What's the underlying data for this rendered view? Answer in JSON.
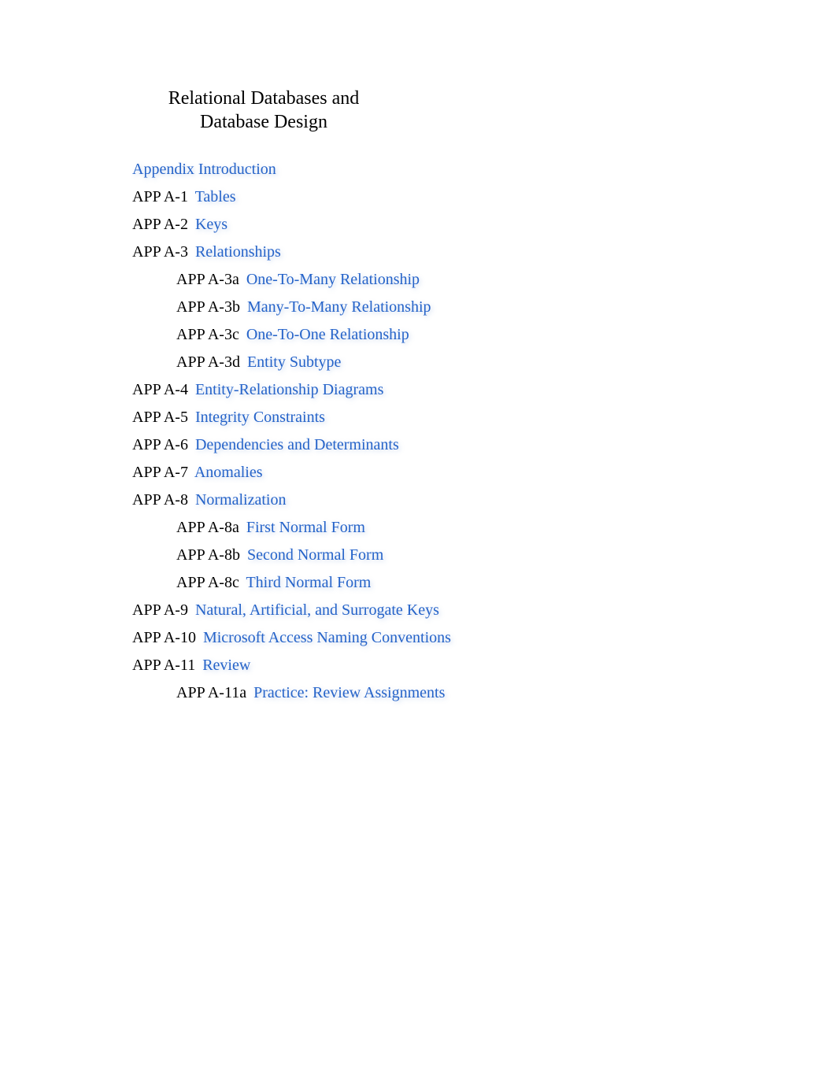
{
  "title": "Relational Databases and Database Design",
  "items": [
    {
      "prefix": "",
      "label": "Appendix Introduction",
      "children": []
    },
    {
      "prefix": "APP A-1",
      "label": "Tables",
      "children": []
    },
    {
      "prefix": "APP A-2",
      "label": "Keys",
      "children": []
    },
    {
      "prefix": "APP A-3",
      "label": "Relationships",
      "children": [
        {
          "prefix": "APP A-3a",
          "label": "One-To-Many Relationship"
        },
        {
          "prefix": "APP A-3b",
          "label": "Many-To-Many Relationship"
        },
        {
          "prefix": "APP A-3c",
          "label": "One-To-One Relationship"
        },
        {
          "prefix": "APP A-3d",
          "label": "Entity Subtype"
        }
      ]
    },
    {
      "prefix": "APP A-4",
      "label": "Entity-Relationship Diagrams",
      "children": []
    },
    {
      "prefix": "APP A-5",
      "label": "Integrity Constraints",
      "children": []
    },
    {
      "prefix": "APP A-6",
      "label": "Dependencies and Determinants",
      "children": []
    },
    {
      "prefix": "APP A-7",
      "label": "Anomalies",
      "children": []
    },
    {
      "prefix": "APP A-8",
      "label": "Normalization",
      "children": [
        {
          "prefix": "APP A-8a",
          "label": "First Normal Form"
        },
        {
          "prefix": "APP A-8b",
          "label": "Second Normal Form"
        },
        {
          "prefix": "APP A-8c",
          "label": "Third Normal Form"
        }
      ]
    },
    {
      "prefix": "APP A-9",
      "label": "Natural, Artificial, and Surrogate Keys",
      "children": []
    },
    {
      "prefix": "APP A-10",
      "label": "Microsoft Access Naming Conventions",
      "children": []
    },
    {
      "prefix": "APP A-11",
      "label": "Review",
      "children": [
        {
          "prefix": "APP A-11a",
          "label": "Practice: Review Assignments"
        }
      ]
    }
  ]
}
